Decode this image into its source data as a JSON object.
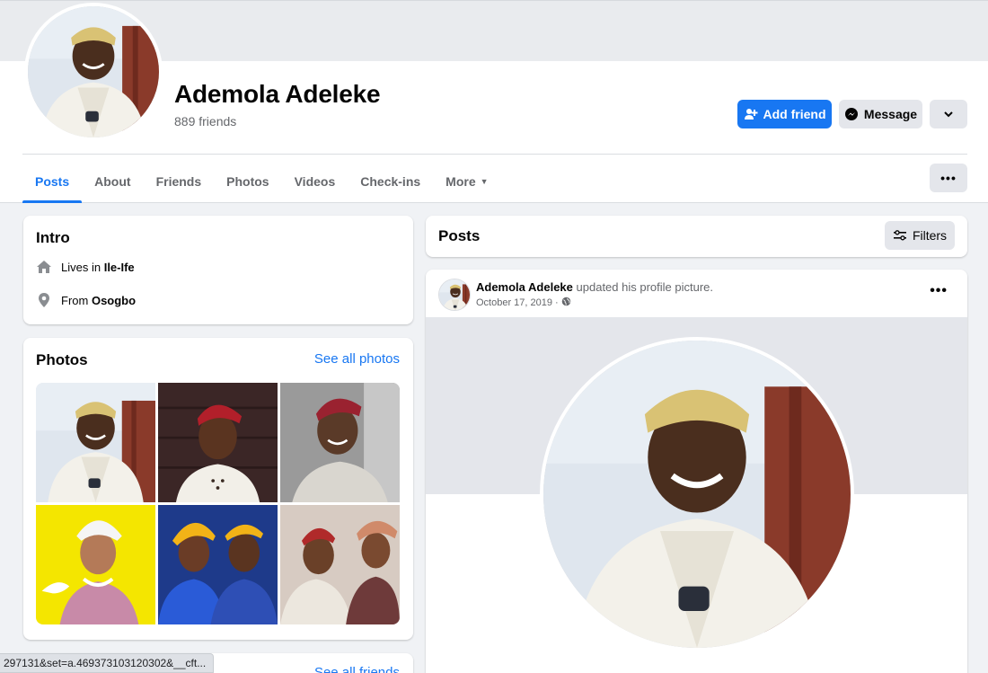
{
  "profile": {
    "name": "Ademola Adeleke",
    "friends_count": "889 friends"
  },
  "actions": {
    "add_friend": "Add friend",
    "message": "Message"
  },
  "tabs": [
    {
      "label": "Posts",
      "active": true
    },
    {
      "label": "About"
    },
    {
      "label": "Friends"
    },
    {
      "label": "Photos"
    },
    {
      "label": "Videos"
    },
    {
      "label": "Check-ins"
    },
    {
      "label": "More"
    }
  ],
  "intro": {
    "title": "Intro",
    "lives_prefix": "Lives in ",
    "lives_city": "Ile-Ife",
    "from_prefix": "From ",
    "from_city": "Osogbo"
  },
  "photos": {
    "title": "Photos",
    "see_all": "See all photos"
  },
  "friends_section": {
    "see_all": "See all friends"
  },
  "posts_header": {
    "title": "Posts",
    "filters": "Filters"
  },
  "post": {
    "author": "Ademola Adeleke",
    "action": " updated his profile picture.",
    "date": "October 17, 2019 ·"
  },
  "status_url": "297131&set=a.469373103120302&__cft...",
  "colors": {
    "accent": "#1877f2",
    "background": "#f0f2f5",
    "secondary_button": "#e4e6eb"
  },
  "icons": [
    "add-person-icon",
    "messenger-icon",
    "chevron-down-icon",
    "more-dots-icon",
    "home-icon",
    "location-pin-icon",
    "filters-icon",
    "globe-icon"
  ]
}
